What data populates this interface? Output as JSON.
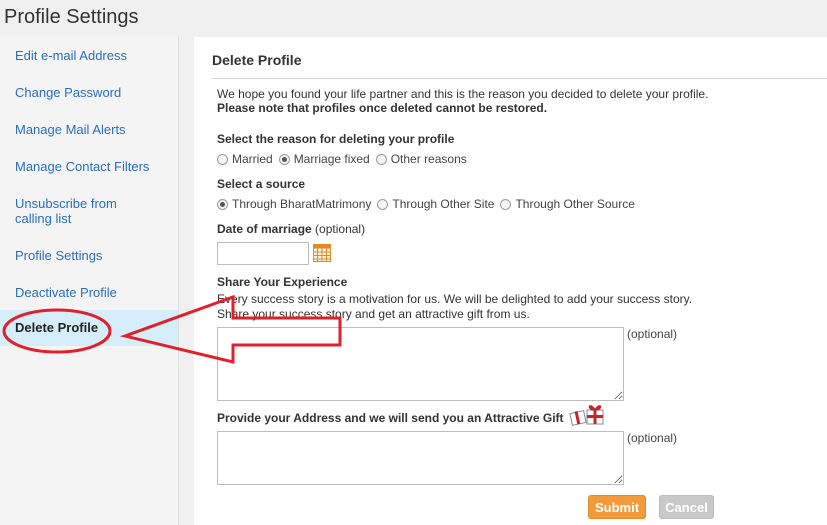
{
  "page": {
    "title": "Profile Settings"
  },
  "sidebar": {
    "items": [
      {
        "label": "Edit e-mail Address"
      },
      {
        "label": "Change Password"
      },
      {
        "label": "Manage Mail Alerts"
      },
      {
        "label": "Manage Contact Filters"
      },
      {
        "label": "Unsubscribe from calling list"
      },
      {
        "label": "Profile Settings"
      },
      {
        "label": "Deactivate Profile"
      },
      {
        "label": "Delete Profile",
        "active": true
      }
    ]
  },
  "panel": {
    "title": "Delete Profile",
    "intro_line1": "We hope you found your life partner and this is the reason you decided to delete your profile.",
    "intro_line2": "Please note that profiles once deleted cannot be restored.",
    "reason": {
      "label": "Select the reason for deleting your profile",
      "options": [
        "Married",
        "Marriage fixed",
        "Other reasons"
      ],
      "selected": "Marriage fixed"
    },
    "source": {
      "label": "Select a source",
      "options": [
        "Through BharatMatrimony",
        "Through Other Site",
        "Through Other Source"
      ],
      "selected": "Through BharatMatrimony"
    },
    "marriage_date": {
      "label": "Date of marriage",
      "optional": "(optional)",
      "value": ""
    },
    "experience": {
      "label": "Share Your Experience",
      "line1": "Every success story is a motivation for us. We will be delighted to add your success story.",
      "line2": "Share your success story and get an attractive gift from us.",
      "optional": "(optional)",
      "value": ""
    },
    "address": {
      "label": "Provide your Address and we will send you an Attractive Gift",
      "optional": "(optional)",
      "value": ""
    },
    "buttons": {
      "submit": "Submit",
      "cancel": "Cancel"
    }
  },
  "icons": {
    "calendar": "calendar-icon",
    "gift": "gift-icon"
  },
  "colors": {
    "link": "#2a6ebb",
    "active_bg": "#d6eef9",
    "submit": "#f39b3c",
    "annotation": "#e0202a"
  }
}
